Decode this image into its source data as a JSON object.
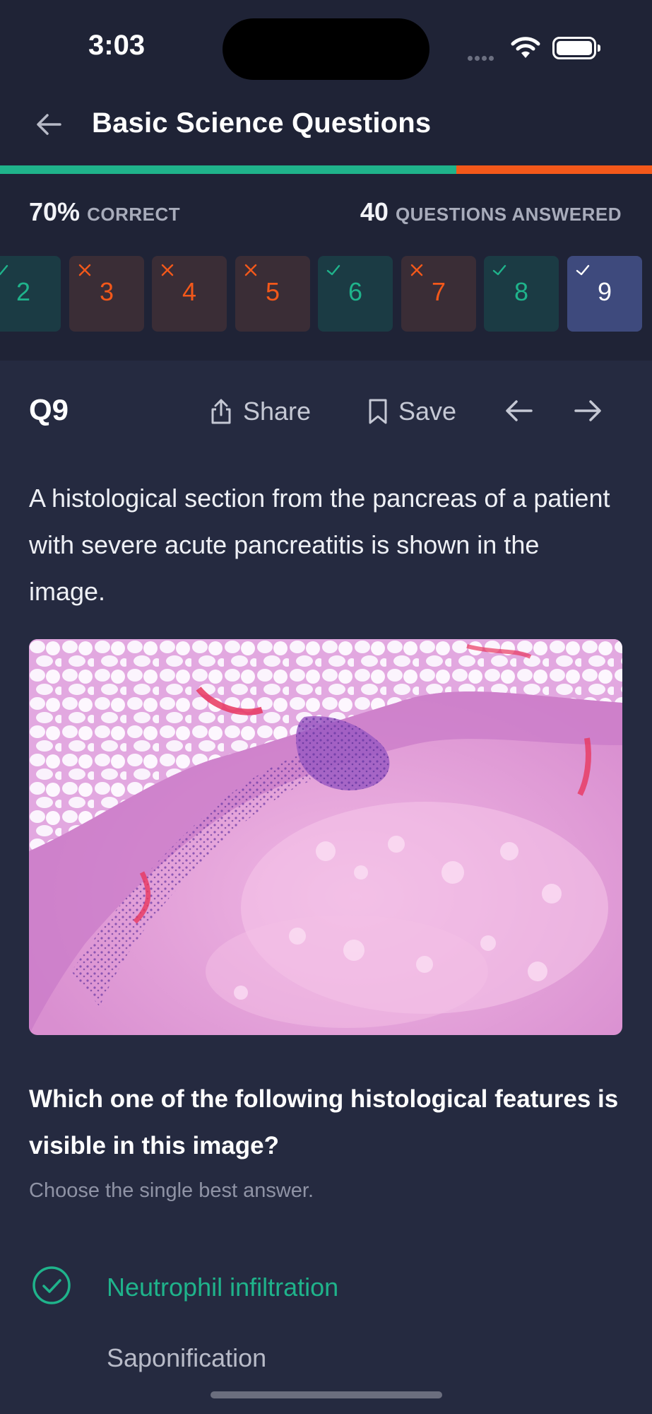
{
  "status_bar": {
    "time": "3:03"
  },
  "header": {
    "title": "Basic Science Questions"
  },
  "progress": {
    "correct_fraction": 0.7,
    "good_color": "#1fb38b",
    "bad_color": "#f3581a"
  },
  "stats": {
    "correct_value": "70%",
    "correct_label": "CORRECT",
    "answered_value": "40",
    "answered_label": "QUESTIONS ANSWERED"
  },
  "question_nav": [
    {
      "number": "2",
      "status": "correct"
    },
    {
      "number": "3",
      "status": "incorrect"
    },
    {
      "number": "4",
      "status": "incorrect"
    },
    {
      "number": "5",
      "status": "incorrect"
    },
    {
      "number": "6",
      "status": "correct"
    },
    {
      "number": "7",
      "status": "incorrect"
    },
    {
      "number": "8",
      "status": "correct"
    },
    {
      "number": "9",
      "status": "current"
    }
  ],
  "question": {
    "label": "Q9",
    "share_label": "Share",
    "save_label": "Save",
    "stem": "A histological section from the pancreas of a patient with severe acute pancreatitis is shown in the image.",
    "prompt": "Which one of the following histological features is visible in this image?",
    "instruction": "Choose the single best answer.",
    "options": [
      {
        "text": "Neutrophil infiltration",
        "state": "selected-correct"
      },
      {
        "text": "Saponification",
        "state": "unselected"
      }
    ]
  }
}
